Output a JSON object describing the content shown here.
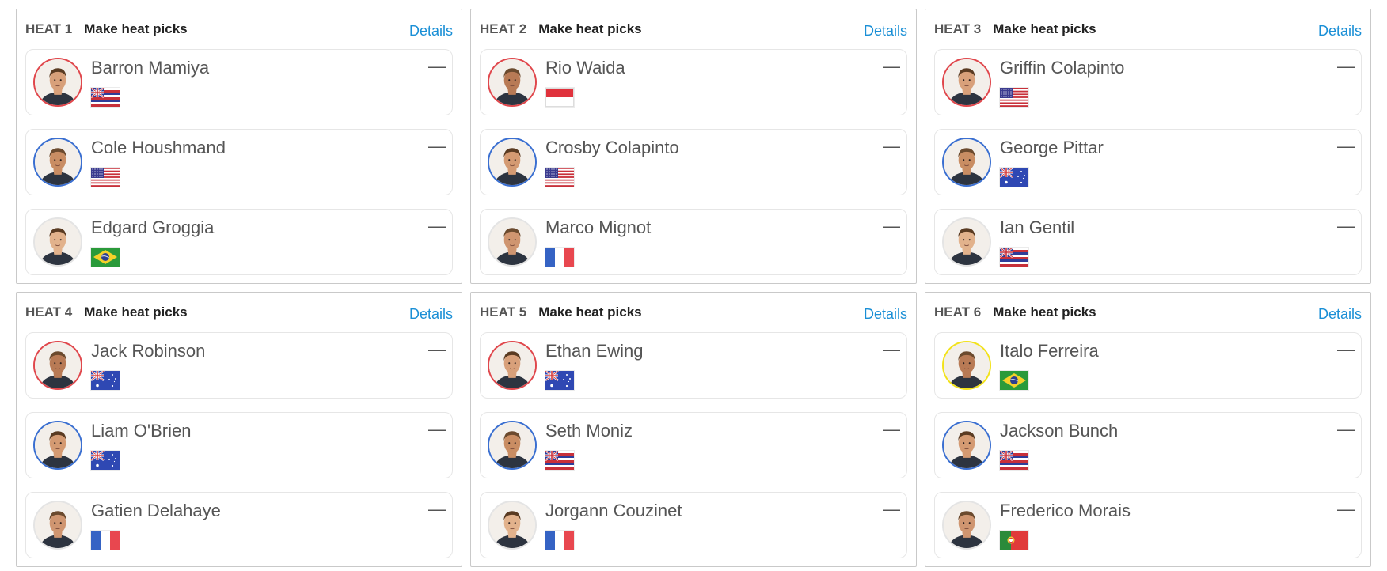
{
  "heats": [
    {
      "label": "HEAT 1",
      "title": "Make heat picks",
      "details": "Details",
      "surfers": [
        {
          "name": "Barron Mamiya",
          "ring": "red",
          "flag": "hawaii",
          "pick": "—"
        },
        {
          "name": "Cole Houshmand",
          "ring": "blue",
          "flag": "usa",
          "pick": "—"
        },
        {
          "name": "Edgard Groggia",
          "ring": "none",
          "flag": "brazil",
          "pick": "—"
        }
      ]
    },
    {
      "label": "HEAT 2",
      "title": "Make heat picks",
      "details": "Details",
      "surfers": [
        {
          "name": "Rio Waida",
          "ring": "red",
          "flag": "indonesia",
          "pick": "—"
        },
        {
          "name": "Crosby Colapinto",
          "ring": "blue",
          "flag": "usa",
          "pick": "—"
        },
        {
          "name": "Marco Mignot",
          "ring": "none",
          "flag": "france",
          "pick": "—"
        }
      ]
    },
    {
      "label": "HEAT 3",
      "title": "Make heat picks",
      "details": "Details",
      "surfers": [
        {
          "name": "Griffin Colapinto",
          "ring": "red",
          "flag": "usa",
          "pick": "—"
        },
        {
          "name": "George Pittar",
          "ring": "blue",
          "flag": "australia",
          "pick": "—"
        },
        {
          "name": "Ian Gentil",
          "ring": "none",
          "flag": "hawaii",
          "pick": "—"
        }
      ]
    },
    {
      "label": "HEAT 4",
      "title": "Make heat picks",
      "details": "Details",
      "surfers": [
        {
          "name": "Jack Robinson",
          "ring": "red",
          "flag": "australia",
          "pick": "—"
        },
        {
          "name": "Liam O'Brien",
          "ring": "blue",
          "flag": "australia",
          "pick": "—"
        },
        {
          "name": "Gatien Delahaye",
          "ring": "none",
          "flag": "france",
          "pick": "—"
        }
      ]
    },
    {
      "label": "HEAT 5",
      "title": "Make heat picks",
      "details": "Details",
      "surfers": [
        {
          "name": "Ethan Ewing",
          "ring": "red",
          "flag": "australia",
          "pick": "—"
        },
        {
          "name": "Seth Moniz",
          "ring": "blue",
          "flag": "hawaii",
          "pick": "—"
        },
        {
          "name": "Jorgann Couzinet",
          "ring": "none",
          "flag": "france",
          "pick": "—"
        }
      ]
    },
    {
      "label": "HEAT 6",
      "title": "Make heat picks",
      "details": "Details",
      "surfers": [
        {
          "name": "Italo Ferreira",
          "ring": "yellow",
          "flag": "brazil",
          "pick": "—"
        },
        {
          "name": "Jackson Bunch",
          "ring": "blue",
          "flag": "hawaii",
          "pick": "—"
        },
        {
          "name": "Frederico Morais",
          "ring": "none",
          "flag": "portugal",
          "pick": "—"
        }
      ]
    }
  ],
  "colors": {
    "ring_red": "#e0474c",
    "ring_blue": "#3a6fd1",
    "ring_yellow": "#f2e21a",
    "link": "#1a8fd6"
  }
}
